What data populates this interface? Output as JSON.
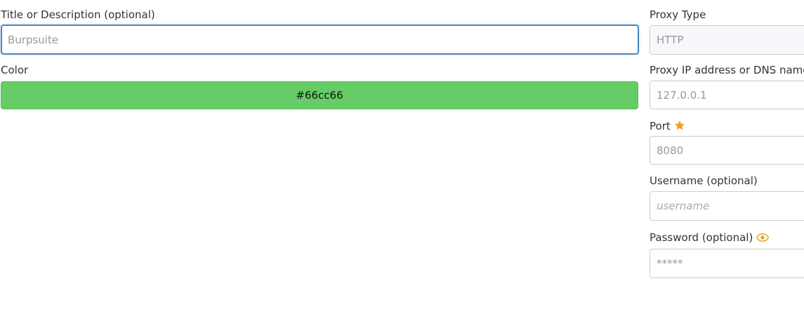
{
  "left": {
    "title_label": "Title or Description (optional)",
    "title_placeholder": "Burpsuite",
    "color_label": "Color",
    "color_value": "#66cc66"
  },
  "right": {
    "proxy_type_label": "Proxy Type",
    "proxy_type_value": "HTTP",
    "address_label": "Proxy IP address or DNS name",
    "address_placeholder": "127.0.0.1",
    "port_label": "Port",
    "port_placeholder": "8080",
    "username_label": "Username (optional)",
    "username_placeholder": "username",
    "password_label": "Password (optional)",
    "password_placeholder": "*****"
  },
  "icons": {
    "port_required": "star-icon",
    "password_toggle": "eye-icon"
  },
  "colors": {
    "accent_orange": "#f0a020",
    "focus_blue": "#4a86c8",
    "swatch": "#66cc66"
  }
}
